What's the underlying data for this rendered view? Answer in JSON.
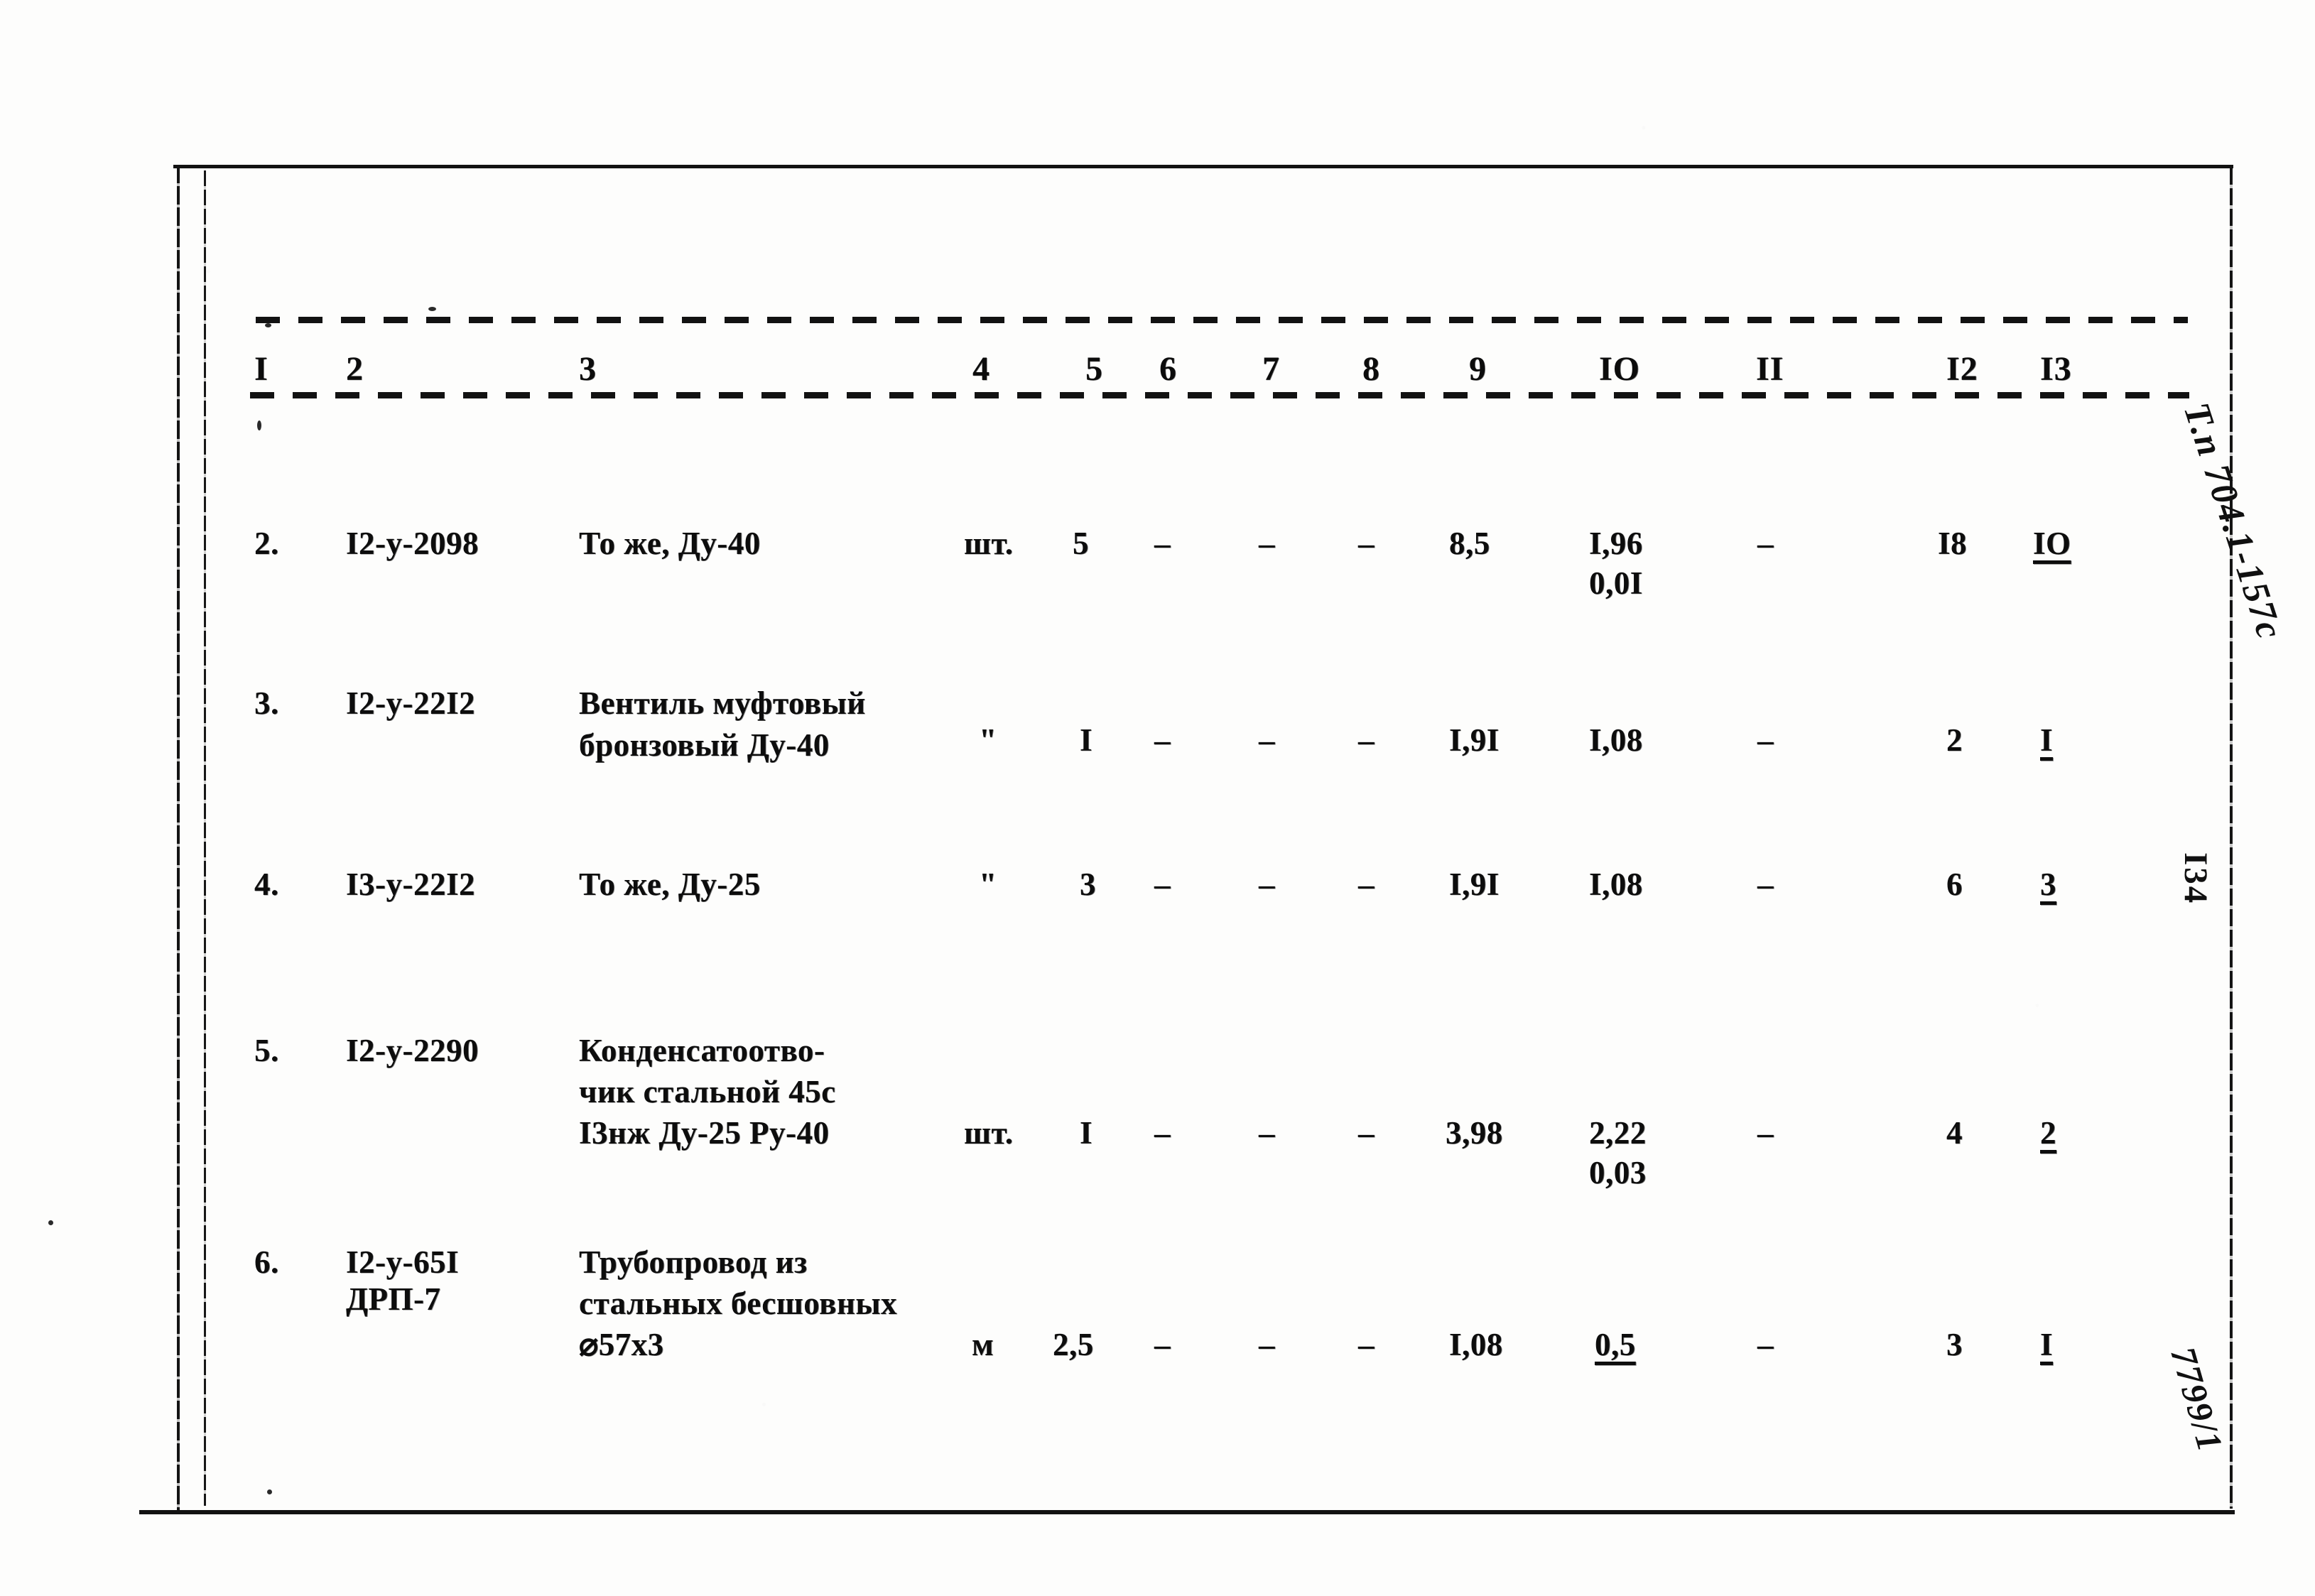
{
  "document": {
    "type": "scanned-spec-table",
    "page_number": "I34",
    "margin_spec_code": "Т.п 704.1-157с",
    "margin_order_code": "7799/1"
  },
  "table": {
    "column_numbers": [
      "I",
      "2",
      "3",
      "4",
      "5",
      "6",
      "7",
      "8",
      "9",
      "IO",
      "II",
      "I2",
      "I3"
    ],
    "dash": "–",
    "ditto": "\"",
    "rows": [
      {
        "num": "2.",
        "code": "I2-у-2098",
        "name_lines": [
          "То же, Ду-40"
        ],
        "unit": "шт.",
        "c5": "5",
        "c6": "–",
        "c7": "–",
        "c8": "–",
        "c9": "8,5",
        "c10_main": "I,96",
        "c10_sub": "0,0I",
        "c11": "–",
        "c12": "I8",
        "c13": "IO",
        "c13_underline": true
      },
      {
        "num": "3.",
        "code": "I2-у-22I2",
        "name_lines": [
          "Вентиль муфтовый",
          "бронзовый Ду-40"
        ],
        "unit": "\"",
        "c5": "I",
        "c6": "–",
        "c7": "–",
        "c8": "–",
        "c9": "I,9I",
        "c10_main": "I,08",
        "c10_sub": "",
        "c11": "–",
        "c12": "2",
        "c13": "I",
        "c13_underline": true
      },
      {
        "num": "4.",
        "code": "I3-у-22I2",
        "name_lines": [
          "То же, Ду-25"
        ],
        "unit": "\"",
        "c5": "3",
        "c6": "–",
        "c7": "–",
        "c8": "–",
        "c9": "I,9I",
        "c10_main": "I,08",
        "c10_sub": "",
        "c11": "–",
        "c12": "6",
        "c13": "3",
        "c13_underline": true
      },
      {
        "num": "5.",
        "code": "I2-у-2290",
        "name_lines": [
          "Конденсатоотво-",
          "чик стальной 45с",
          "I3нж Ду-25 Ру-40"
        ],
        "unit": "шт.",
        "c5": "I",
        "c6": "–",
        "c7": "–",
        "c8": "–",
        "c9": "3,98",
        "c10_main": "2,22",
        "c10_sub": "0,03",
        "c11": "–",
        "c12": "4",
        "c13": "2",
        "c13_underline": true
      },
      {
        "num": "6.",
        "code": "I2-у-65I",
        "code_line2": "ДРП-7",
        "name_lines": [
          "Трубопровод из",
          "стальных бесшовных",
          "⌀57х3"
        ],
        "unit": "м",
        "c5": "2,5",
        "c6": "–",
        "c7": "–",
        "c8": "–",
        "c9": "I,08",
        "c10_main": "0,5",
        "c10_main_underline": true,
        "c10_sub": "",
        "c11": "–",
        "c12": "3",
        "c13": "I",
        "c13_underline": true
      }
    ]
  }
}
